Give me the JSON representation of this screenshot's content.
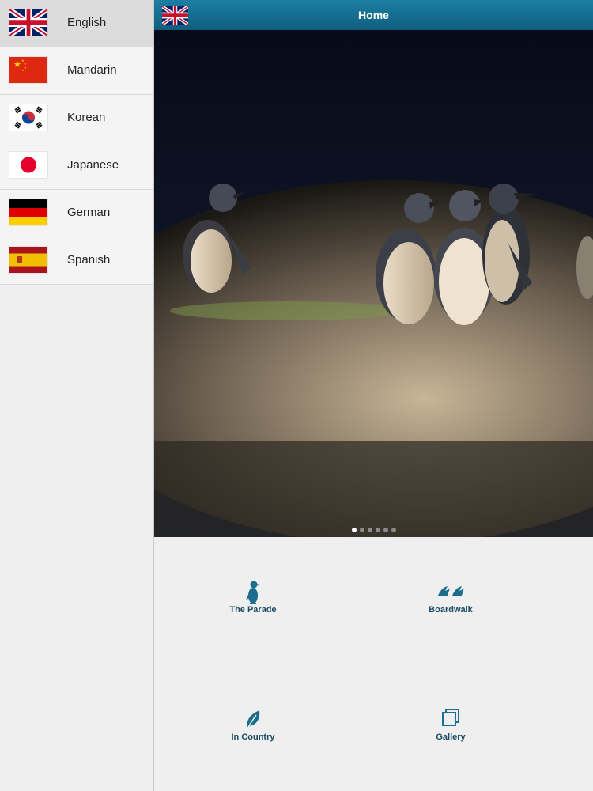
{
  "sidebar": {
    "languages": [
      {
        "label": "English",
        "icon": "uk-flag-icon",
        "selected": true
      },
      {
        "label": "Mandarin",
        "icon": "china-flag-icon"
      },
      {
        "label": "Korean",
        "icon": "korea-flag-icon"
      },
      {
        "label": "Japanese",
        "icon": "japan-flag-icon"
      },
      {
        "label": "German",
        "icon": "germany-flag-icon"
      },
      {
        "label": "Spanish",
        "icon": "spain-flag-icon"
      }
    ]
  },
  "header": {
    "title": "Home",
    "language_icon": "uk-flag-icon",
    "bar_color": "#16708f"
  },
  "hero": {
    "image": "penguins walking on sand at dusk",
    "page_count": 6,
    "active_page": 1
  },
  "tiles": [
    {
      "label": "The Parade",
      "icon": "penguin-icon"
    },
    {
      "label": "Boardwalk",
      "icon": "footprints-icon"
    },
    {
      "label": "In Country",
      "icon": "leaf-icon"
    },
    {
      "label": "Gallery",
      "icon": "gallery-icon"
    }
  ],
  "accent_color": "#1a6d8c"
}
